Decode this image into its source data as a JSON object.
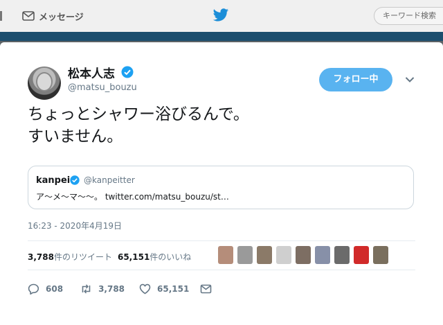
{
  "header": {
    "messages_label": "メッセージ",
    "search_placeholder": "キーワード検索",
    "brand_color": "#1da1f2"
  },
  "tweet": {
    "display_name": "松本人志",
    "username": "@matsu_bouzu",
    "follow_label": "フォロー中",
    "text_lines": [
      "ちょっとシャワー浴びるんで。",
      "すいません。"
    ],
    "quote": {
      "name": "kanpei",
      "handle": "@kanpeitter",
      "text": "ア〜メ〜マ〜〜。 twitter.com/matsu_bouzu/st…"
    },
    "timestamp": "16:23 - 2020年4月19日",
    "stats": {
      "retweets_count": "3,788",
      "retweets_label": "件のリツイート",
      "likes_count": "65,151",
      "likes_label": "件のいいね"
    },
    "actions": {
      "reply_count": "608",
      "retweet_count": "3,788",
      "like_count": "65,151"
    }
  }
}
